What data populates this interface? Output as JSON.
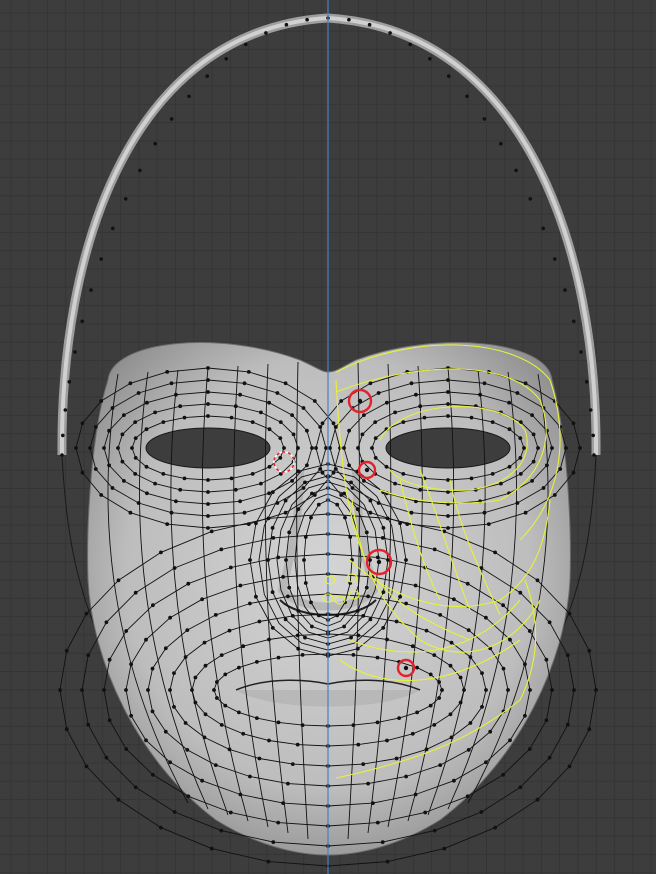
{
  "viewport": {
    "grid_color": "#353535",
    "background_color": "#3d3d3d",
    "symmetry_axis_color": "#4a7fc4",
    "mesh_surface_color": "#c8c8c8",
    "mesh_wire_color": "#111111",
    "guide_curve_color": "#e6f23a",
    "marker_color": "#e3222b"
  },
  "icons": {
    "marker": "circle-highlight-icon",
    "cursor": "3d-cursor-icon"
  },
  "markers": {
    "count": 4
  }
}
